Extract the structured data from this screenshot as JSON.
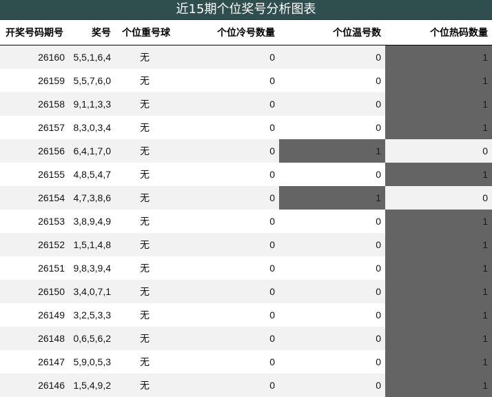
{
  "title": "近15期个位奖号分析图表",
  "headers": [
    "开奖号码期号",
    "奖号",
    "个位重号球",
    "个位冷号数量",
    "个位温号数",
    "个位热码数量"
  ],
  "highlight_color": "#646464",
  "rows": [
    {
      "period": "26160",
      "numbers": "5,5,1,6,4",
      "repeat": "无",
      "cold": "0",
      "warm": "0",
      "hot": "1"
    },
    {
      "period": "26159",
      "numbers": "5,5,7,6,0",
      "repeat": "无",
      "cold": "0",
      "warm": "0",
      "hot": "1"
    },
    {
      "period": "26158",
      "numbers": "9,1,1,3,3",
      "repeat": "无",
      "cold": "0",
      "warm": "0",
      "hot": "1"
    },
    {
      "period": "26157",
      "numbers": "8,3,0,3,4",
      "repeat": "无",
      "cold": "0",
      "warm": "0",
      "hot": "1"
    },
    {
      "period": "26156",
      "numbers": "6,4,1,7,0",
      "repeat": "无",
      "cold": "0",
      "warm": "1",
      "hot": "0"
    },
    {
      "period": "26155",
      "numbers": "4,8,5,4,7",
      "repeat": "无",
      "cold": "0",
      "warm": "0",
      "hot": "1"
    },
    {
      "period": "26154",
      "numbers": "4,7,3,8,6",
      "repeat": "无",
      "cold": "0",
      "warm": "1",
      "hot": "0"
    },
    {
      "period": "26153",
      "numbers": "3,8,9,4,9",
      "repeat": "无",
      "cold": "0",
      "warm": "0",
      "hot": "1"
    },
    {
      "period": "26152",
      "numbers": "1,5,1,4,8",
      "repeat": "无",
      "cold": "0",
      "warm": "0",
      "hot": "1"
    },
    {
      "period": "26151",
      "numbers": "9,8,3,9,4",
      "repeat": "无",
      "cold": "0",
      "warm": "0",
      "hot": "1"
    },
    {
      "period": "26150",
      "numbers": "3,4,0,7,1",
      "repeat": "无",
      "cold": "0",
      "warm": "0",
      "hot": "1"
    },
    {
      "period": "26149",
      "numbers": "3,2,5,3,3",
      "repeat": "无",
      "cold": "0",
      "warm": "0",
      "hot": "1"
    },
    {
      "period": "26148",
      "numbers": "0,6,5,6,2",
      "repeat": "无",
      "cold": "0",
      "warm": "0",
      "hot": "1"
    },
    {
      "period": "26147",
      "numbers": "5,9,0,5,3",
      "repeat": "无",
      "cold": "0",
      "warm": "0",
      "hot": "1"
    },
    {
      "period": "26146",
      "numbers": "1,5,4,9,2",
      "repeat": "无",
      "cold": "0",
      "warm": "0",
      "hot": "1"
    }
  ]
}
